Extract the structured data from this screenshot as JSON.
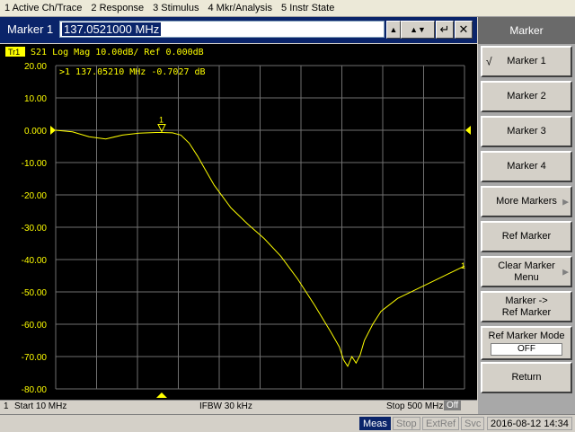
{
  "menu": [
    "1 Active Ch/Trace",
    "2 Response",
    "3 Stimulus",
    "4 Mkr/Analysis",
    "5 Instr State"
  ],
  "entry": {
    "label": "Marker 1",
    "value": "137.0521000 MHz"
  },
  "trace": {
    "header": "S21  Log Mag 10.00dB/ Ref 0.000dB",
    "tag": "Tr1",
    "marker_readout": ">1  137.05210 MHz  -0.7027 dB",
    "marker_id": "1",
    "trace_color": "#ffff00",
    "grid_color": "#707070"
  },
  "chart_data": {
    "type": "line",
    "xlabel": "",
    "ylabel": "",
    "x_range_mhz": [
      10,
      500
    ],
    "ylim": [
      -80,
      20
    ],
    "y_ticks": [
      "20.00",
      "10.00",
      "0.000",
      "-10.00",
      "-20.00",
      "-30.00",
      "-40.00",
      "-50.00",
      "-60.00",
      "-70.00",
      "-80.00"
    ],
    "grid": true,
    "series": [
      {
        "x": [
          10,
          30,
          50,
          70,
          90,
          110,
          130,
          137,
          150,
          160,
          170,
          180,
          190,
          200,
          220,
          240,
          260,
          280,
          300,
          320,
          340,
          350,
          355,
          360,
          365,
          370,
          375,
          380,
          390,
          400,
          420,
          440,
          460,
          480,
          500
        ],
        "values": [
          0,
          -0.5,
          -2.0,
          -2.7,
          -1.5,
          -0.9,
          -0.7,
          -0.7,
          -0.8,
          -1.5,
          -4.0,
          -8.0,
          -12.5,
          -17.0,
          -24.0,
          -29.0,
          -33.5,
          -39.0,
          -46.0,
          -54.0,
          -62.5,
          -67.0,
          -71.0,
          -73.0,
          -70.0,
          -72.0,
          -69.5,
          -65.0,
          -60.0,
          -56.0,
          -52.0,
          -49.5,
          -47.0,
          -44.5,
          -42.0
        ]
      }
    ]
  },
  "status": {
    "channel": "1",
    "start": "Start 10 MHz",
    "ifbw": "IFBW 30 kHz",
    "stop": "Stop 500 MHz",
    "off": "Off"
  },
  "bottom": {
    "meas": "Meas",
    "stop": "Stop",
    "extref": "ExtRef",
    "svc": "Svc",
    "datetime": "2016-08-12 14:34"
  },
  "softkeys": {
    "title": "Marker",
    "marker1": "Marker 1",
    "marker2": "Marker 2",
    "marker3": "Marker 3",
    "marker4": "Marker 4",
    "more_markers": "More Markers",
    "ref_marker": "Ref Marker",
    "clear_marker_menu_1": "Clear Marker",
    "clear_marker_menu_2": "Menu",
    "marker_to_ref_1": "Marker ->",
    "marker_to_ref_2": "Ref Marker",
    "ref_marker_mode": "Ref Marker Mode",
    "ref_marker_mode_value": "OFF",
    "return": "Return"
  }
}
